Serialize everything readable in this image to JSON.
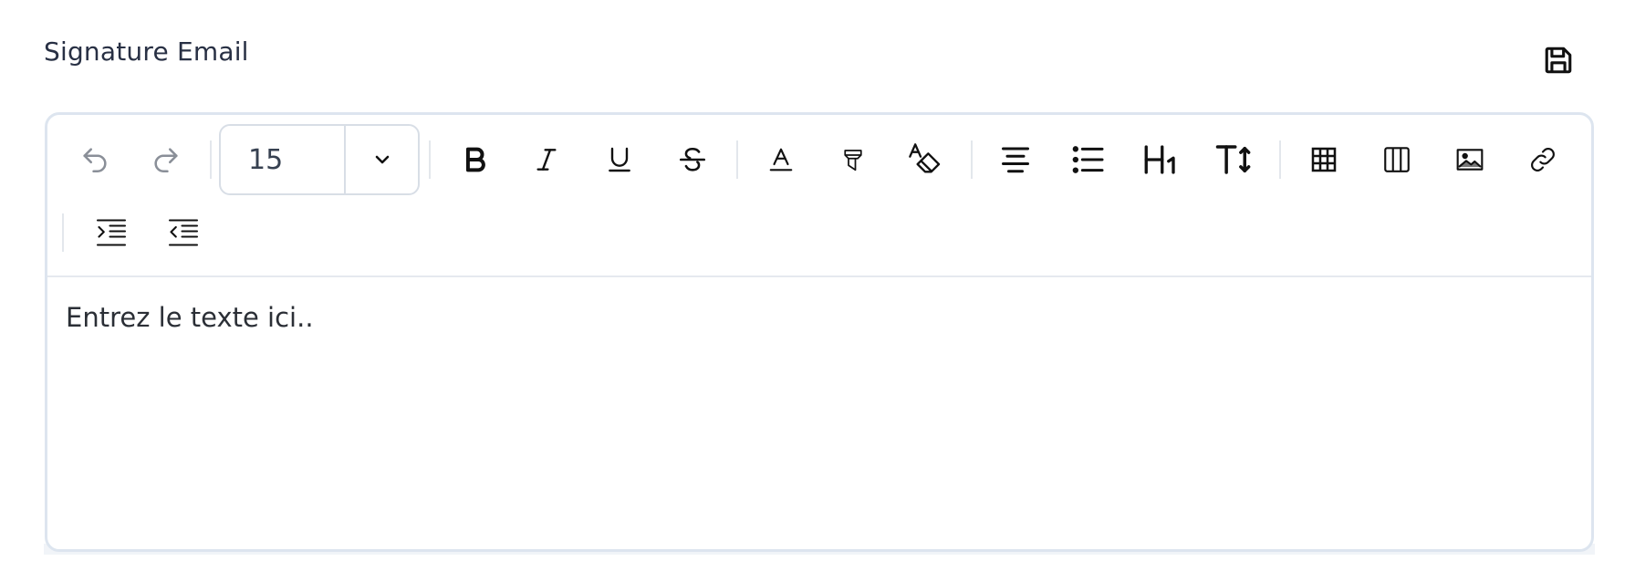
{
  "header": {
    "title": "Signature Email",
    "save_icon": "floppy-disk-icon"
  },
  "toolbar": {
    "font_size": "15",
    "buttons": [
      {
        "name": "undo-icon",
        "state": "disabled"
      },
      {
        "name": "redo-icon",
        "state": "disabled"
      },
      {
        "name": "bold-icon"
      },
      {
        "name": "italic-icon"
      },
      {
        "name": "underline-icon"
      },
      {
        "name": "strikethrough-icon"
      },
      {
        "name": "font-color-icon"
      },
      {
        "name": "highlighter-icon"
      },
      {
        "name": "clear-format-icon"
      },
      {
        "name": "align-center-icon"
      },
      {
        "name": "bullet-list-icon"
      },
      {
        "name": "heading-icon"
      },
      {
        "name": "line-height-icon"
      },
      {
        "name": "table-icon"
      },
      {
        "name": "columns-icon"
      },
      {
        "name": "image-icon"
      },
      {
        "name": "link-icon"
      },
      {
        "name": "indent-icon"
      },
      {
        "name": "outdent-icon"
      }
    ]
  },
  "editor": {
    "placeholder": "Entrez le texte ici.."
  },
  "colors": {
    "title": "#283044",
    "border": "#dde5ef",
    "icon": "#111111",
    "icon_disabled": "#8a8f98",
    "text": "#2b2f36"
  }
}
